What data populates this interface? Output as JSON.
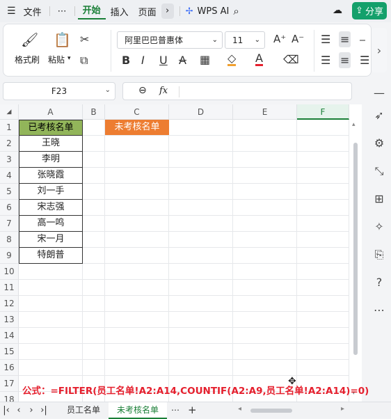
{
  "menubar": {
    "items": [
      "文件",
      "⋯",
      "开始",
      "插入",
      "页面"
    ],
    "wps_ai": "WPS AI",
    "share": "分享"
  },
  "ribbon": {
    "format_painter": "格式刷",
    "paste": "粘贴",
    "font_name": "阿里巴巴普惠体",
    "font_size": "11"
  },
  "formula_bar": {
    "cell_ref": "F23",
    "fx": "fx",
    "content": ""
  },
  "columns": [
    "A",
    "B",
    "C",
    "D",
    "E",
    "F"
  ],
  "rows": [
    "1",
    "2",
    "3",
    "4",
    "5",
    "6",
    "7",
    "8",
    "9",
    "10",
    "11",
    "12",
    "13",
    "14",
    "15",
    "16",
    "17",
    "18"
  ],
  "sheet": {
    "A1": "已考核名单",
    "names": [
      "王晓",
      "李明",
      "张晓霞",
      "刘一手",
      "宋志强",
      "高一鸣",
      "宋一月",
      "特朗普"
    ],
    "C1": "未考核名单"
  },
  "overlay_formula": "公式：=FILTER(员工名单!A2:A14,COUNTIF(A2:A9,员工名单!A2:A14)=0)",
  "tabs": {
    "sheet1": "员工名单",
    "sheet2": "未考核名单",
    "more": "⋯",
    "add": "+"
  },
  "colors": {
    "header_green": "#92b55a",
    "orange": "#ed7d31",
    "accent": "#1a7f37",
    "formula_red": "#e5202e"
  }
}
